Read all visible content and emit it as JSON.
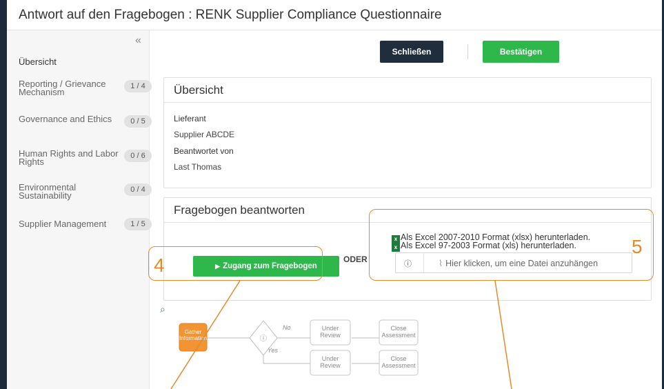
{
  "title": "Antwort auf den Fragebogen : RENK Supplier Compliance Questionnaire",
  "sidebar": {
    "collapse_glyph": "«",
    "overview_label": "Übersicht",
    "items": [
      {
        "label": "Reporting / Grievance Mechanism",
        "badge": "1 / 4"
      },
      {
        "label": "Governance and Ethics",
        "badge": "0 / 5"
      },
      {
        "label": "Human Rights and Labor Rights",
        "badge": "0 / 6"
      },
      {
        "label": "Environmental Sustainability",
        "badge": "0 / 4"
      },
      {
        "label": "Supplier Management",
        "badge": "1 / 5"
      }
    ]
  },
  "toolbar": {
    "close_label": "Schließen",
    "confirm_label": "Bestätigen"
  },
  "overview_panel": {
    "header": "Übersicht",
    "supplier_label": "Lieferant",
    "supplier_value": "Supplier ABCDE",
    "answered_by_label": "Beantwortet von",
    "answered_by_value": "Last Thomas"
  },
  "answer_panel": {
    "header": "Fragebogen beantworten",
    "access_button": "Zugang zum Fragebogen",
    "or_label": "ODER",
    "download_xlsx": "Als Excel 2007-2010 Format (xlsx) herunterladen.",
    "download_xls": "Als Excel 97-2003 Format (xls) herunterladen.",
    "attach_placeholder": "Hier klicken, um eine Datei anzuhängen"
  },
  "annotations": {
    "four": "4",
    "five": "5"
  },
  "workflow": {
    "gather": "Gather Information",
    "no": "No",
    "yes": "Yes",
    "under_review": "Under Review",
    "close_assessment": "Close Assessment"
  },
  "colors": {
    "accent_green": "#2eb84c",
    "dark_navy": "#1f2d3d",
    "annotation_orange": "#e58a2a",
    "gather_orange": "#f29434"
  }
}
